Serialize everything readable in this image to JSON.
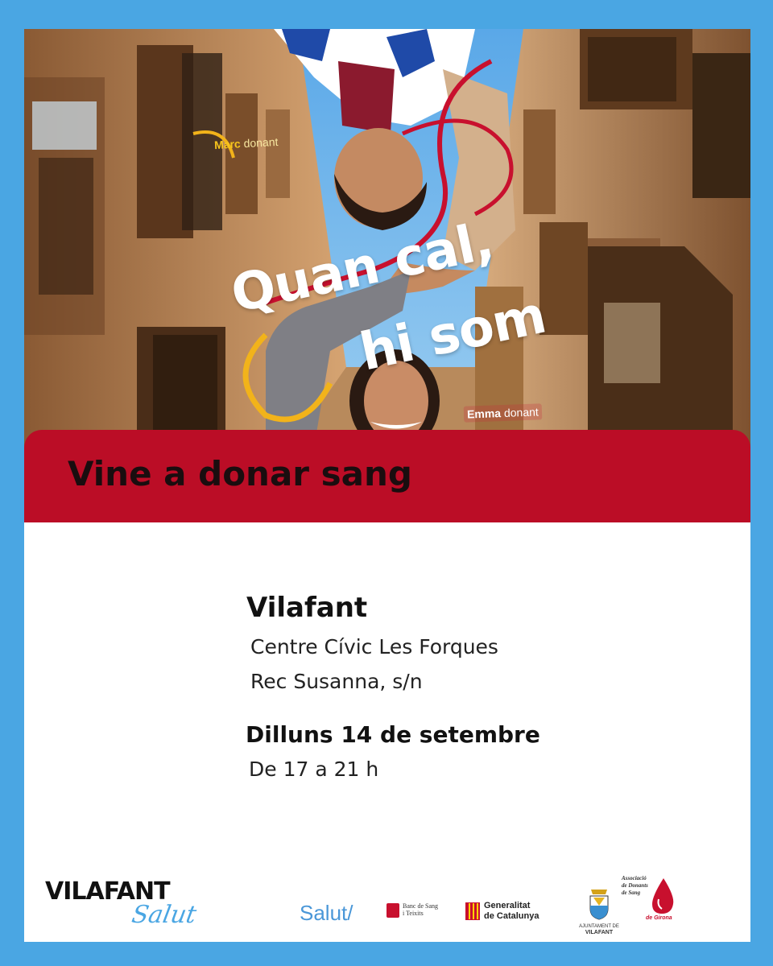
{
  "colors": {
    "frame": "#4aa6e3",
    "banner": "#bb0d26",
    "card": "#ffffff"
  },
  "photo": {
    "slogan_line1": "Quan cal,",
    "slogan_line2": "hi som",
    "tag_marc_name": "Marc",
    "tag_marc_role": "donant",
    "tag_emma_name": "Emma",
    "tag_emma_role": "donant"
  },
  "banner": {
    "title": "Vine a donar sang"
  },
  "event": {
    "town": "Vilafant",
    "venue": "Centre Cívic Les Forques",
    "address": "Rec Susanna, s/n",
    "date": "Dilluns 14 de setembre",
    "hours": "De 17 a 21 h"
  },
  "footer": {
    "vilafant_logo_name": "VILAFANT",
    "vilafant_logo_sub": "Salut",
    "salut_logo": "Salut/",
    "banc_line1": "Banc de Sang",
    "banc_line2": "i Teixits",
    "generalitat_line1": "Generalitat",
    "generalitat_line2": "de Catalunya",
    "ajuntament_line1": "AJUNTAMENT DE",
    "ajuntament_line2": "VILAFANT",
    "associacio_line1": "Associació",
    "associacio_line2": "de Donants",
    "associacio_line3": "de Sang",
    "associacio_line4": "de Girona"
  }
}
